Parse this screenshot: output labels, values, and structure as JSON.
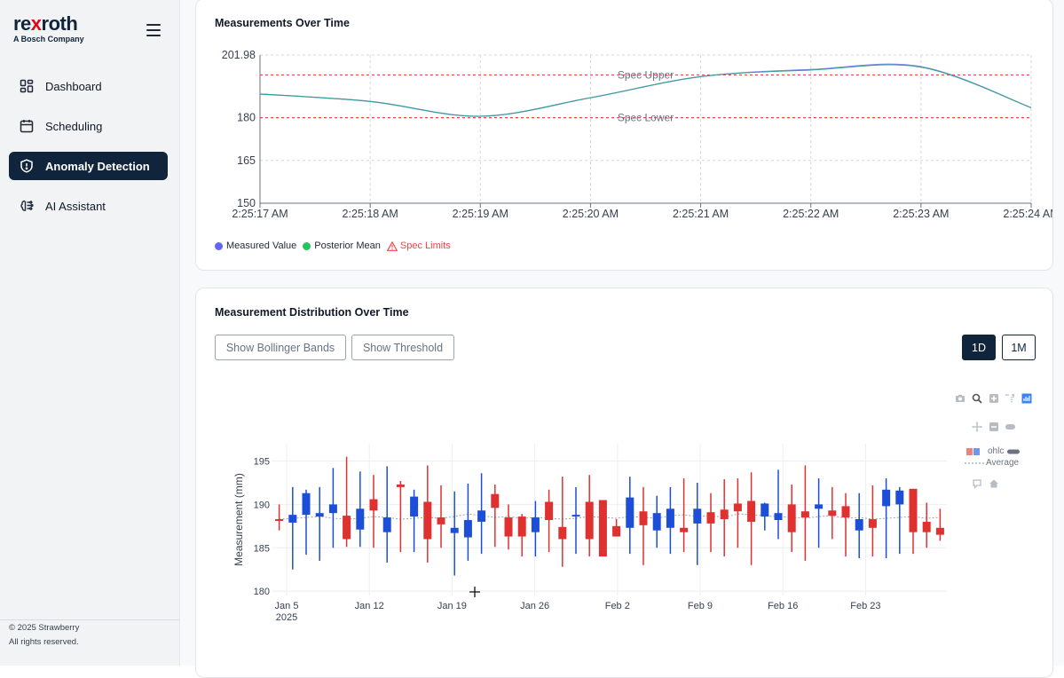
{
  "brand": {
    "name_prefix": "re",
    "name_accent": "x",
    "name_suffix": "roth",
    "subtitle": "A Bosch Company"
  },
  "sidebar": {
    "items": [
      {
        "label": "Dashboard",
        "icon": "dashboard-icon",
        "active": false
      },
      {
        "label": "Scheduling",
        "icon": "calendar-icon",
        "active": false
      },
      {
        "label": "Anomaly Detection",
        "icon": "shield-icon",
        "active": true
      },
      {
        "label": "AI Assistant",
        "icon": "brain-icon",
        "active": false
      }
    ],
    "footer": {
      "copyright": "© 2025 Strawberry",
      "rights": "All rights reserved."
    }
  },
  "card1": {
    "title": "Measurements Over Time",
    "legend": {
      "measured": "Measured Value",
      "posterior": "Posterior Mean",
      "spec": "Spec Limits"
    },
    "colors": {
      "measured": "#6366f1",
      "posterior": "#22c55e",
      "spec": "#ef4444"
    }
  },
  "card2": {
    "title": "Measurement Distribution Over Time",
    "buttons": {
      "bollinger": "Show Bollinger Bands",
      "threshold": "Show Threshold"
    },
    "timeframes": [
      {
        "label": "1D",
        "active": true
      },
      {
        "label": "1M",
        "active": false
      }
    ],
    "legend": {
      "ohlc": "ohlc",
      "average": "Average"
    }
  },
  "chart_data": [
    {
      "type": "line",
      "title": "Measurements Over Time",
      "x": [
        "2:25:17 AM",
        "2:25:18 AM",
        "2:25:19 AM",
        "2:25:20 AM",
        "2:25:21 AM",
        "2:25:22 AM",
        "2:25:23 AM",
        "2:25:24 AM"
      ],
      "y_ticks": [
        150,
        165,
        180,
        201.98
      ],
      "ylim": [
        150,
        201.98
      ],
      "series": [
        {
          "name": "Measured Value",
          "values": [
            188.3,
            185.7,
            180.5,
            187,
            194.4,
            196.9,
            197.9,
            183.5
          ]
        },
        {
          "name": "Posterior Mean",
          "values": [
            188.3,
            185.7,
            180.5,
            187,
            194.4,
            196.7,
            197.7,
            183.5
          ]
        }
      ],
      "spec_limits": [
        {
          "name": "Spec Upper",
          "value": 195
        },
        {
          "name": "Spec Lower",
          "value": 180
        }
      ],
      "grid": true
    },
    {
      "type": "candlestick",
      "ylabel": "Measurement (mm)",
      "x_ticks": [
        "Jan 5",
        "Jan 12",
        "Jan 19",
        "Jan 26",
        "Feb 2",
        "Feb 9",
        "Feb 16",
        "Feb 23"
      ],
      "x_tick_sub": "2025",
      "y_ticks": [
        180,
        185,
        190,
        195
      ],
      "ylim": [
        179.5,
        197
      ],
      "candles": [
        {
          "o": 188.3,
          "c": 188.1,
          "h": 190.0,
          "l": 187.0,
          "up": false
        },
        {
          "o": 187.9,
          "c": 188.8,
          "h": 192.0,
          "l": 182.5,
          "up": true
        },
        {
          "o": 188.8,
          "c": 191.3,
          "h": 191.7,
          "l": 184.2,
          "up": true
        },
        {
          "o": 188.6,
          "c": 189.0,
          "h": 192.0,
          "l": 183.5,
          "up": true
        },
        {
          "o": 189.0,
          "c": 190.0,
          "h": 194.2,
          "l": 185.0,
          "up": true
        },
        {
          "o": 188.7,
          "c": 186.0,
          "h": 195.5,
          "l": 185.1,
          "up": false
        },
        {
          "o": 187.1,
          "c": 189.5,
          "h": 193.8,
          "l": 185.1,
          "up": true
        },
        {
          "o": 190.6,
          "c": 189.3,
          "h": 193.4,
          "l": 185.0,
          "up": false
        },
        {
          "o": 186.8,
          "c": 188.5,
          "h": 194.4,
          "l": 183.3,
          "up": true
        },
        {
          "o": 192.3,
          "c": 192.0,
          "h": 192.7,
          "l": 184.5,
          "up": false
        },
        {
          "o": 188.6,
          "c": 190.9,
          "h": 191.7,
          "l": 184.5,
          "up": true
        },
        {
          "o": 190.3,
          "c": 186.0,
          "h": 194.5,
          "l": 183.3,
          "up": false
        },
        {
          "o": 188.5,
          "c": 187.7,
          "h": 192.2,
          "l": 185.0,
          "up": false
        },
        {
          "o": 186.7,
          "c": 187.3,
          "h": 191.5,
          "l": 181.8,
          "up": true
        },
        {
          "o": 186.2,
          "c": 188.2,
          "h": 192.4,
          "l": 183.5,
          "up": true
        },
        {
          "o": 188.0,
          "c": 189.3,
          "h": 193.6,
          "l": 184.3,
          "up": true
        },
        {
          "o": 191.2,
          "c": 189.6,
          "h": 192.3,
          "l": 185.1,
          "up": false
        },
        {
          "o": 188.5,
          "c": 186.3,
          "h": 190.0,
          "l": 184.8,
          "up": false
        },
        {
          "o": 188.6,
          "c": 186.3,
          "h": 188.9,
          "l": 184.0,
          "up": false
        },
        {
          "o": 186.8,
          "c": 188.5,
          "h": 190.4,
          "l": 184.0,
          "up": true
        },
        {
          "o": 190.3,
          "c": 188.2,
          "h": 191.7,
          "l": 184.5,
          "up": false
        },
        {
          "o": 187.4,
          "c": 186.0,
          "h": 193.2,
          "l": 182.8,
          "up": false
        },
        {
          "o": 188.6,
          "c": 188.8,
          "h": 192.0,
          "l": 184.3,
          "up": true
        },
        {
          "o": 190.3,
          "c": 186.0,
          "h": 193.4,
          "l": 184.0,
          "up": false
        },
        {
          "o": 190.5,
          "c": 184.0,
          "h": 190.5,
          "l": 184.0,
          "up": false
        },
        {
          "o": 187.5,
          "c": 186.3,
          "h": 188.3,
          "l": 186.3,
          "up": false
        },
        {
          "o": 187.3,
          "c": 190.8,
          "h": 193.2,
          "l": 184.3,
          "up": true
        },
        {
          "o": 189.2,
          "c": 187.6,
          "h": 192.0,
          "l": 183.0,
          "up": false
        },
        {
          "o": 187.0,
          "c": 189.0,
          "h": 191.0,
          "l": 185.0,
          "up": true
        },
        {
          "o": 187.3,
          "c": 189.5,
          "h": 192.0,
          "l": 184.3,
          "up": true
        },
        {
          "o": 187.3,
          "c": 186.8,
          "h": 193.0,
          "l": 184.5,
          "up": false
        },
        {
          "o": 187.8,
          "c": 189.5,
          "h": 192.5,
          "l": 183.0,
          "up": true
        },
        {
          "o": 189.1,
          "c": 187.8,
          "h": 191.3,
          "l": 184.5,
          "up": false
        },
        {
          "o": 189.4,
          "c": 188.3,
          "h": 192.9,
          "l": 184.0,
          "up": false
        },
        {
          "o": 190.1,
          "c": 189.2,
          "h": 193.0,
          "l": 185.0,
          "up": false
        },
        {
          "o": 190.4,
          "c": 188.0,
          "h": 193.7,
          "l": 183.0,
          "up": false
        },
        {
          "o": 188.6,
          "c": 190.1,
          "h": 190.2,
          "l": 187.0,
          "up": true
        },
        {
          "o": 188.2,
          "c": 189.0,
          "h": 194.0,
          "l": 186.0,
          "up": true
        },
        {
          "o": 190.0,
          "c": 186.8,
          "h": 192.3,
          "l": 184.5,
          "up": false
        },
        {
          "o": 189.2,
          "c": 188.5,
          "h": 194.5,
          "l": 183.5,
          "up": false
        },
        {
          "o": 189.5,
          "c": 190.0,
          "h": 193.0,
          "l": 185.0,
          "up": true
        },
        {
          "o": 189.3,
          "c": 188.7,
          "h": 192.0,
          "l": 186.0,
          "up": false
        },
        {
          "o": 189.8,
          "c": 188.5,
          "h": 191.3,
          "l": 184.0,
          "up": false
        },
        {
          "o": 187.0,
          "c": 188.3,
          "h": 191.3,
          "l": 183.8,
          "up": true
        },
        {
          "o": 188.3,
          "c": 187.3,
          "h": 192.2,
          "l": 184.0,
          "up": false
        },
        {
          "o": 189.8,
          "c": 191.7,
          "h": 193.0,
          "l": 183.8,
          "up": true
        },
        {
          "o": 190.0,
          "c": 191.6,
          "h": 192.0,
          "l": 184.3,
          "up": true
        },
        {
          "o": 191.8,
          "c": 186.8,
          "h": 191.8,
          "l": 184.3,
          "up": false
        },
        {
          "o": 188.0,
          "c": 186.8,
          "h": 190.2,
          "l": 185.0,
          "up": false
        },
        {
          "o": 187.3,
          "c": 186.5,
          "h": 189.5,
          "l": 185.8,
          "up": false
        }
      ],
      "average": [
        188.3,
        188.4,
        188.5,
        188.6,
        188.4,
        188.3,
        188.4,
        188.6,
        188.5,
        188.3,
        188.4,
        188.5,
        188.4,
        188.6,
        188.9,
        188.7,
        188.5,
        188.6,
        188.4,
        188.5,
        188.4,
        188.3,
        188.4,
        188.6,
        188.5,
        188.4,
        188.6,
        188.5,
        188.4,
        188.7,
        188.8,
        188.6,
        188.7,
        188.5,
        188.9,
        188.8,
        188.7,
        188.6,
        188.5,
        188.4,
        188.6,
        188.7,
        188.4,
        188.5,
        188.3,
        188.4,
        188.5,
        188.6,
        188.4,
        188.5
      ],
      "colors": {
        "up": "#1d4ed8",
        "down": "#e03131"
      },
      "grid": true
    }
  ]
}
